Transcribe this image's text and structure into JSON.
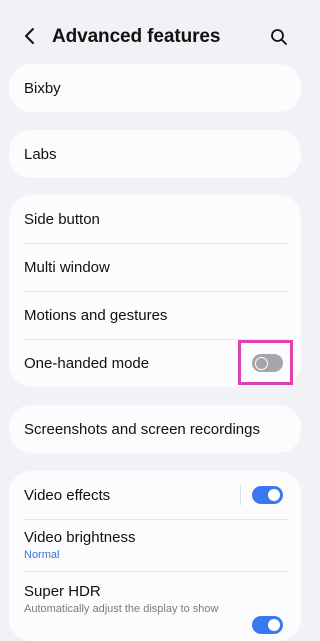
{
  "header": {
    "title": "Advanced features",
    "back_icon": "chevron-left-icon",
    "search_icon": "search-icon"
  },
  "cards": {
    "bixby": "Bixby",
    "labs": "Labs",
    "group1": {
      "side_button": "Side button",
      "multi_window": "Multi window",
      "motions": "Motions and gestures",
      "one_handed": "One-handed mode"
    },
    "screenshots": "Screenshots and screen recordings",
    "group2": {
      "video_effects": "Video effects",
      "video_brightness": "Video brightness",
      "video_brightness_value": "Normal",
      "super_hdr": "Super HDR",
      "super_hdr_desc": "Automatically adjust the display to show"
    }
  },
  "toggles": {
    "one_handed_mode": false,
    "video_effects": true,
    "super_hdr": true
  },
  "colors": {
    "accent": "#3a78f2",
    "highlight": "#e040b0",
    "background": "#f2f1f6"
  }
}
